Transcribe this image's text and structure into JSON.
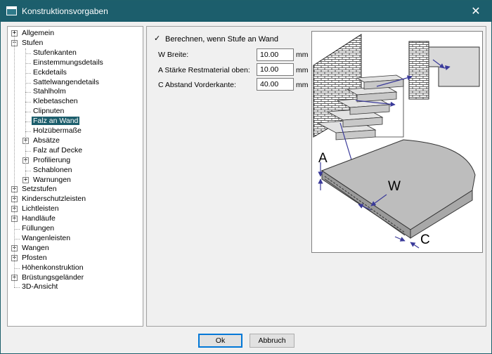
{
  "window": {
    "title": "Konstruktionsvorgaben",
    "close_glyph": "✕",
    "icon": "app-window-icon"
  },
  "tree": {
    "items": [
      {
        "label": "Allgemein",
        "level": 0,
        "expander": "+",
        "selected": false
      },
      {
        "label": "Stufen",
        "level": 0,
        "expander": "−",
        "selected": false
      },
      {
        "label": "Stufenkanten",
        "level": 1,
        "expander": "",
        "selected": false
      },
      {
        "label": "Einstemmungsdetails",
        "level": 1,
        "expander": "",
        "selected": false
      },
      {
        "label": "Eckdetails",
        "level": 1,
        "expander": "",
        "selected": false
      },
      {
        "label": "Sattelwangendetails",
        "level": 1,
        "expander": "",
        "selected": false
      },
      {
        "label": "Stahlholm",
        "level": 1,
        "expander": "",
        "selected": false
      },
      {
        "label": "Klebetaschen",
        "level": 1,
        "expander": "",
        "selected": false
      },
      {
        "label": "Clipnuten",
        "level": 1,
        "expander": "",
        "selected": false
      },
      {
        "label": "Falz an Wand",
        "level": 1,
        "expander": "",
        "selected": true
      },
      {
        "label": "Holzübermaße",
        "level": 1,
        "expander": "",
        "selected": false
      },
      {
        "label": "Absätze",
        "level": 1,
        "expander": "+",
        "selected": false
      },
      {
        "label": "Falz auf Decke",
        "level": 1,
        "expander": "",
        "selected": false
      },
      {
        "label": "Profilierung",
        "level": 1,
        "expander": "+",
        "selected": false
      },
      {
        "label": "Schablonen",
        "level": 1,
        "expander": "",
        "selected": false
      },
      {
        "label": "Warnungen",
        "level": 1,
        "expander": "+",
        "selected": false
      },
      {
        "label": "Setzstufen",
        "level": 0,
        "expander": "+",
        "selected": false
      },
      {
        "label": "Kinderschutzleisten",
        "level": 0,
        "expander": "+",
        "selected": false
      },
      {
        "label": "Lichtleisten",
        "level": 0,
        "expander": "+",
        "selected": false
      },
      {
        "label": "Handläufe",
        "level": 0,
        "expander": "+",
        "selected": false
      },
      {
        "label": "Füllungen",
        "level": 0,
        "expander": "",
        "selected": false
      },
      {
        "label": "Wangenleisten",
        "level": 0,
        "expander": "",
        "selected": false
      },
      {
        "label": "Wangen",
        "level": 0,
        "expander": "+",
        "selected": false
      },
      {
        "label": "Pfosten",
        "level": 0,
        "expander": "+",
        "selected": false
      },
      {
        "label": "Höhenkonstruktion",
        "level": 0,
        "expander": "",
        "selected": false
      },
      {
        "label": "Brüstungsgeländer",
        "level": 0,
        "expander": "+",
        "selected": false
      },
      {
        "label": "3D-Ansicht",
        "level": 0,
        "expander": "",
        "selected": false
      }
    ]
  },
  "settings": {
    "checkbox": {
      "label": "Berechnen, wenn Stufe an Wand",
      "checked": true,
      "glyph": "✓"
    },
    "fields": [
      {
        "label": "W Breite:",
        "value": "10.00",
        "unit": "mm"
      },
      {
        "label": "A Stärke Restmaterial oben:",
        "value": "10.00",
        "unit": "mm"
      },
      {
        "label": "C Abstand Vorderkante:",
        "value": "40.00",
        "unit": "mm"
      }
    ]
  },
  "diagram": {
    "labels": {
      "a": "A",
      "w": "W",
      "c": "C"
    },
    "colors": {
      "arrow": "#3a3a9a",
      "step": "#d8d8d8",
      "face": "#b4b4b4"
    }
  },
  "buttons": {
    "ok": "Ok",
    "cancel": "Abbruch"
  }
}
